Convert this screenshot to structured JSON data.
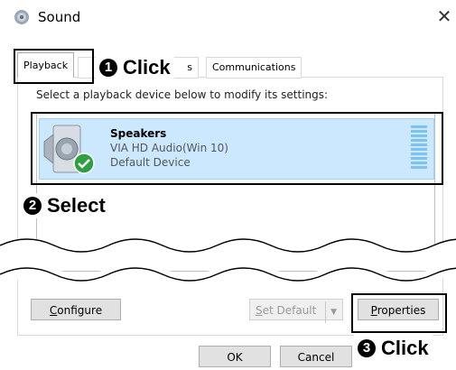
{
  "window": {
    "title": "Sound",
    "close_glyph": "✕",
    "app_icon": "speaker-icon"
  },
  "tabs": {
    "playback": "Playback",
    "recording_partial": "s",
    "communications": "Communications"
  },
  "instruction": "Select a playback device below to modify its settings:",
  "device": {
    "name": "Speakers",
    "driver": "VIA HD Audio(Win 10)",
    "status": "Default Device",
    "icon": "speaker-icon",
    "status_icon": "green-check-icon"
  },
  "buttons": {
    "configure_u": "C",
    "configure_rest": "onfigure",
    "set_default_u": "S",
    "set_default_rest": "et Default",
    "properties_u": "P",
    "properties_rest": "roperties",
    "ok": "OK",
    "cancel": "Cancel"
  },
  "annotations": {
    "step1_num": "1",
    "step1_text": "Click",
    "step2_num": "2",
    "step2_text": "Select",
    "step3_num": "3",
    "step3_text": "Click"
  },
  "colors": {
    "selection_fill": "#cce8ff",
    "selection_border": "#99d1ff",
    "check_green": "#2ea043",
    "meter": "#7ec3ef"
  }
}
